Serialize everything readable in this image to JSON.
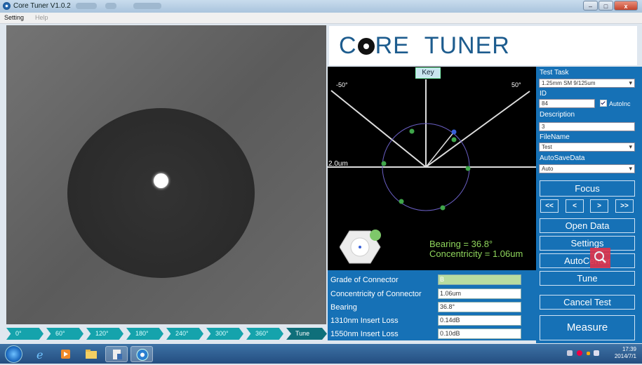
{
  "window": {
    "title": "Core Tuner V1.0.2",
    "controls": {
      "minimize": "–",
      "maximize": "□",
      "close": "x"
    }
  },
  "menu": [
    "Setting",
    "Help"
  ],
  "angle_steps": [
    "0°",
    "60°",
    "120°",
    "180°",
    "240°",
    "300°",
    "360°",
    "Tune"
  ],
  "logo": {
    "part1": "C",
    "part2": "RE",
    "part3": "TUNER"
  },
  "plot": {
    "key_label": "Key",
    "left_angle": "-50°",
    "right_angle": "50°",
    "scale_label": "2.0um",
    "bearing_text": "Bearing = 36.8°",
    "concentricity_text": "Concentricity = 1.06um"
  },
  "results": [
    {
      "label": "Grade of Connector",
      "value": "B"
    },
    {
      "label": "Concentricity of Connector",
      "value": "1.06um"
    },
    {
      "label": "Bearing",
      "value": "36.8°"
    },
    {
      "label": "1310nm Insert Loss",
      "value": "0.14dB"
    },
    {
      "label": "1550nm Insert Loss",
      "value": "0.10dB"
    }
  ],
  "side": {
    "test_task_label": "Test Task",
    "test_task_value": "1.25mm SM 9/125um",
    "id_label": "ID",
    "id_value": "84",
    "autoinc_label": "AutoInc",
    "description_label": "Description",
    "description_value": "3",
    "filename_label": "FileName",
    "filename_value": "Test",
    "autosave_label": "AutoSaveData",
    "autosave_value": "Auto",
    "focus": "Focus",
    "nav": [
      "<<",
      "<",
      ">",
      ">>"
    ],
    "open_data": "Open Data",
    "settings": "Settings",
    "autocenter": "AutoCenter",
    "tune": "Tune",
    "cancel_test": "Cancel Test",
    "measure": "Measure"
  },
  "taskbar": {
    "time": "17:39",
    "date": "2014/7/1"
  },
  "colors": {
    "panel_blue": "#1671b6",
    "angle_teal": "#15a3ac",
    "readout_green": "#8fd65c",
    "logo_blue": "#1d5c8e"
  }
}
